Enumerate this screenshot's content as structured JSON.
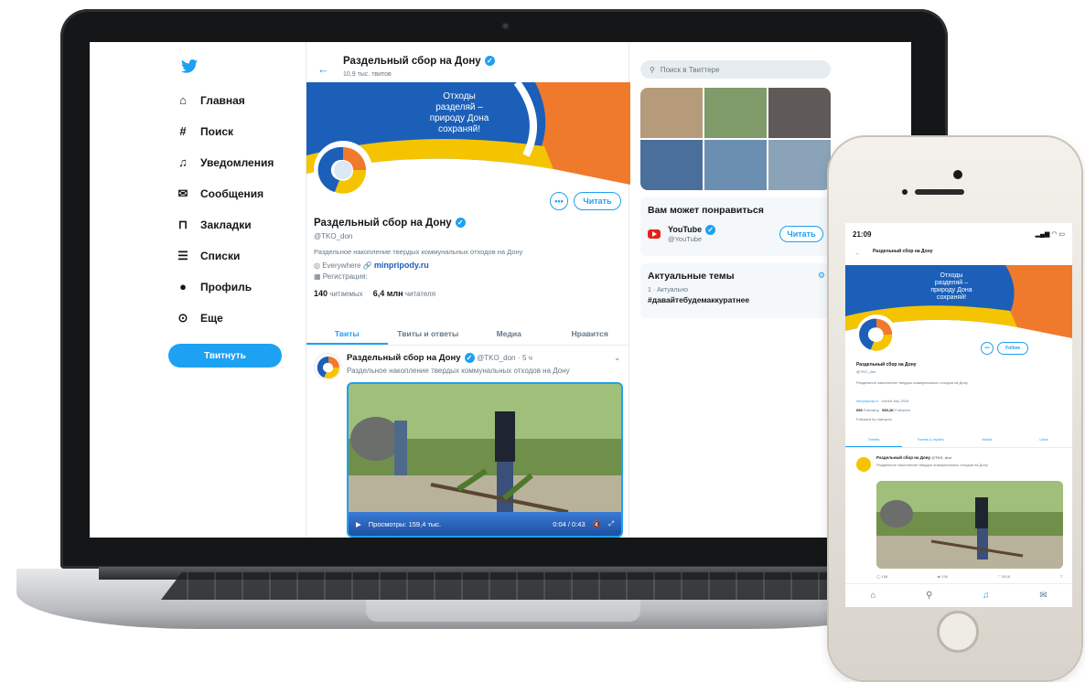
{
  "sidebar": {
    "items": [
      {
        "label": "Главная",
        "icon": "home-icon"
      },
      {
        "label": "Поиск",
        "icon": "hashtag-icon"
      },
      {
        "label": "Уведомления",
        "icon": "bell-icon"
      },
      {
        "label": "Сообщения",
        "icon": "mail-icon"
      },
      {
        "label": "Закладки",
        "icon": "bookmark-icon"
      },
      {
        "label": "Списки",
        "icon": "list-icon"
      },
      {
        "label": "Профиль",
        "icon": "profile-icon"
      },
      {
        "label": "Еще",
        "icon": "more-icon"
      }
    ],
    "tweet_button": "Твитнуть"
  },
  "header": {
    "title": "Раздельный сбор на Дону",
    "subtitle": "10,9 тыс. твитов"
  },
  "banner": {
    "lines": [
      "Отходы",
      "разделяй –",
      "природу Дона",
      "сохраняй!"
    ]
  },
  "profile": {
    "follow_label": "Читать",
    "name": "Раздельный сбор на Дону",
    "handle": "@TKO_don",
    "bio": "Раздельное накопление твердых коммунальных отходов на Дону",
    "location": "Everywhere",
    "website": "minpripody.ru",
    "registration": "Регистрация:",
    "following_count": "140",
    "following_label": "читаемых",
    "followers_count": "6,4 млн",
    "followers_label": "читателя"
  },
  "tabs": [
    "Твиты",
    "Твиты и ответы",
    "Медиа",
    "Нравится"
  ],
  "tweet": {
    "name": "Раздельный сбор на Дону",
    "handle": "@TKO_don",
    "time": "· 5 ч",
    "text": "Раздельное накопление твердых коммунальных отходов на Дону",
    "views": "Просмотры: 159,4 тыс.",
    "duration": "0:04 / 0:43"
  },
  "right": {
    "search_placeholder": "Поиск в Твиттере",
    "suggest_title": "Вам может понравиться",
    "suggest_name": "YouTube",
    "suggest_handle": "@YouTube",
    "suggest_button": "Читать",
    "trends_title": "Актуальные темы",
    "trend_meta": "1 · Актуально",
    "trend_tag": "#давайтебудемаккуратнее"
  },
  "phone": {
    "time": "21:09",
    "title": "Раздельный сбор на Дону",
    "banner_lines": [
      "Отходы",
      "разделяй –",
      "природу Дона",
      "сохраняй!"
    ],
    "follow_label": "Follow",
    "name": "Раздельный сбор на Дону",
    "handle": "@TKO_don",
    "bio": "Раздельное накопление твердых коммунальных отходов на Дону",
    "website": "minpripody.ru",
    "joined": "Joined July 2019",
    "following": "650",
    "following_label": "Following",
    "followers": "535,1K",
    "followers_label": "Followers",
    "followed_by": "Followed by marcymo",
    "tabs": [
      "Tweets",
      "Tweets & replies",
      "Media",
      "Likes"
    ],
    "tweet_name": "Раздельный сбор на Дону",
    "tweet_handle": "@TKO_don",
    "tweet_text": "Раздельное накопление твердых коммунальных отходов на Дону",
    "actions": [
      "108",
      "136",
      "2K16",
      ""
    ]
  },
  "colors": {
    "accent": "#1da1f2",
    "banner_blue": "#1b5fb8",
    "banner_yellow": "#f5c400",
    "banner_orange": "#f07a2b"
  }
}
